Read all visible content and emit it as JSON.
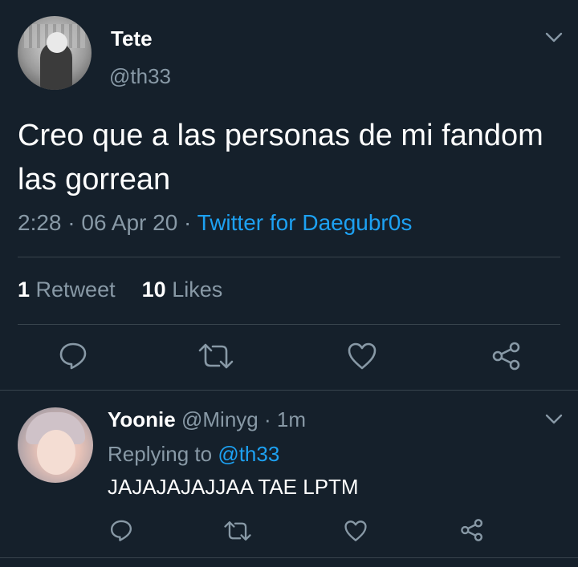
{
  "main_tweet": {
    "display_name": "Tete",
    "handle": "@th33",
    "text": "Creo que a las personas de mi fandom las gorrean",
    "time": "2:28",
    "separator": "·",
    "date": "06 Apr 20",
    "source": "Twitter for Daegubr0s",
    "retweet_count": "1",
    "retweet_label": "Retweet",
    "like_count": "10",
    "like_label": "Likes"
  },
  "reply_tweet": {
    "display_name": "Yoonie",
    "handle": "@Minyg",
    "separator": "·",
    "time_ago": "1m",
    "replying_to_label": "Replying to",
    "replying_to_handle": "@th33",
    "text": "JAJAJAJAJJAA TAE LPTM"
  },
  "icons": {
    "reply": "comment-icon",
    "retweet": "retweet-icon",
    "like": "heart-icon",
    "share": "share-icon",
    "more": "chevron-down-icon"
  },
  "colors": {
    "background": "#15202b",
    "accent": "#1da1f2",
    "secondary_text": "#8899a6",
    "divider": "#38444d"
  }
}
